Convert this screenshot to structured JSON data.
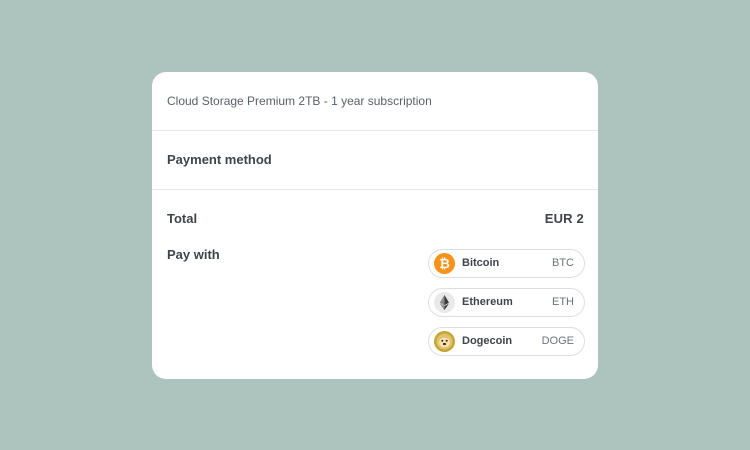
{
  "product": {
    "description": "Cloud Storage Premium 2TB - 1 year subscription"
  },
  "payment": {
    "title": "Payment method",
    "total_label": "Total",
    "total_value": "EUR 2",
    "pay_with_label": "Pay with"
  },
  "coins": [
    {
      "name": "Bitcoin",
      "ticker": "BTC",
      "icon": "bitcoin-icon",
      "color": "#f7931a"
    },
    {
      "name": "Ethereum",
      "ticker": "ETH",
      "icon": "ethereum-icon",
      "color": "#e6e6e6"
    },
    {
      "name": "Dogecoin",
      "ticker": "DOGE",
      "icon": "dogecoin-icon",
      "color": "#c2a633"
    }
  ],
  "colors": {
    "background": "#adc3bd",
    "card": "#ffffff",
    "text_dark": "#3f4449",
    "text_muted": "#5b6168",
    "border": "#dcdfe2"
  }
}
